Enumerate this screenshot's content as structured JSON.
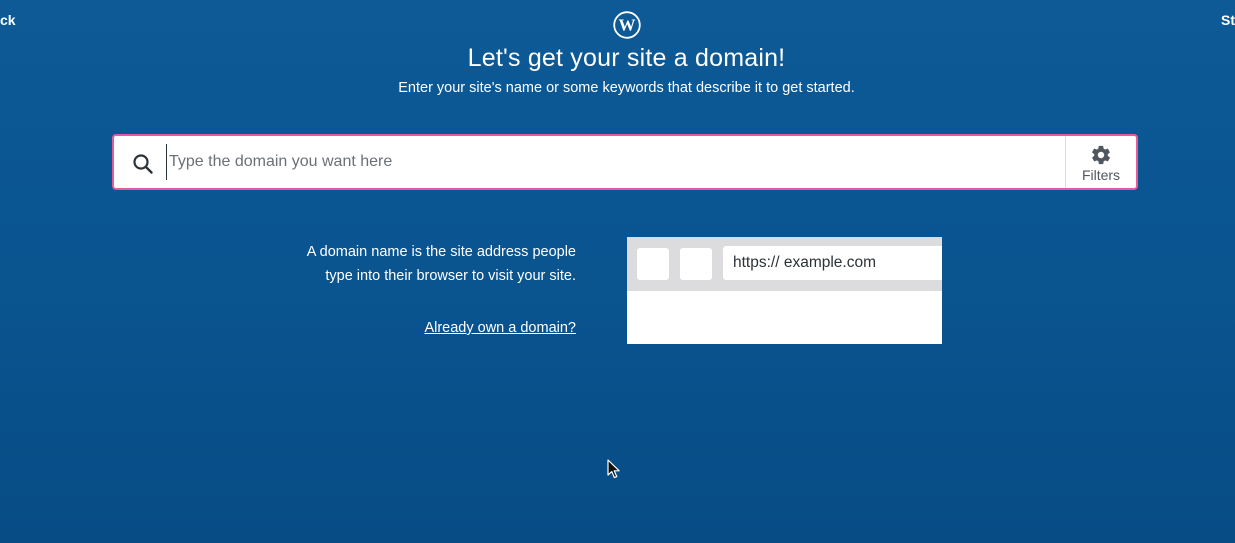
{
  "nav": {
    "back_label": "ck",
    "steps_label": "St"
  },
  "header": {
    "logo_icon": "wordpress-logo-icon",
    "title": "Let's get your site a domain!",
    "subtitle": "Enter your site's name or some keywords that describe it to get started."
  },
  "search": {
    "placeholder": "Type the domain you want here",
    "value": "",
    "icon": "search-icon",
    "filters_label": "Filters",
    "filters_icon": "gear-icon"
  },
  "info": {
    "description": "A domain name is the site address people type into their browser to visit your site.",
    "own_domain_link": "Already own a domain?"
  },
  "illustration": {
    "url_text": "https:// example.com"
  },
  "colors": {
    "background": "#0a5591",
    "search_border": "#e35b9a",
    "text": "#ffffff"
  }
}
